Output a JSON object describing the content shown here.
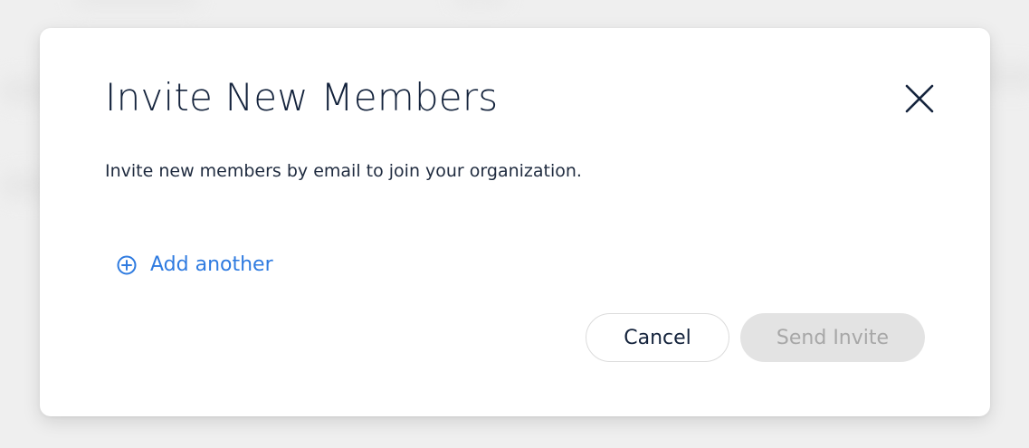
{
  "modal": {
    "title": "Invite New Members",
    "description": "Invite new members by email to join your organization.",
    "add_another_label": "Add another",
    "cancel_label": "Cancel",
    "send_label": "Send Invite",
    "close_icon": "close-icon",
    "add_icon": "plus-circle-icon"
  },
  "colors": {
    "title": "#14233c",
    "link": "#2f7be0",
    "disabled_button_bg": "#e3e3e3",
    "disabled_button_text": "#a7a7a7"
  }
}
